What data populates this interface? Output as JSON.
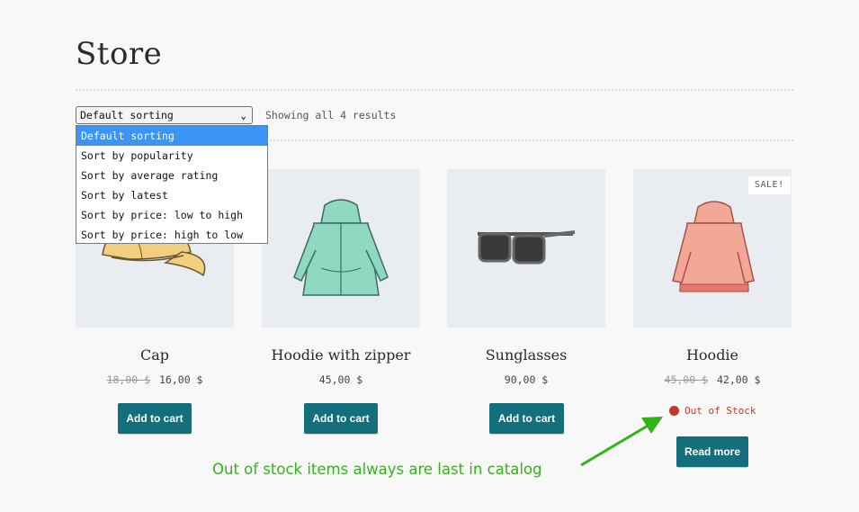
{
  "page": {
    "title": "Store"
  },
  "toolbar": {
    "sort_selected": "Default sorting",
    "results_text": "Showing all 4 results",
    "sort_options": [
      "Default sorting",
      "Sort by popularity",
      "Sort by average rating",
      "Sort by latest",
      "Sort by price: low to high",
      "Sort by price: high to low"
    ]
  },
  "products": [
    {
      "name": "Cap",
      "old_price": "18,00 $",
      "price": "16,00 $",
      "button": "Add to cart"
    },
    {
      "name": "Hoodie with zipper",
      "price": "45,00 $",
      "button": "Add to cart"
    },
    {
      "name": "Sunglasses",
      "price": "90,00 $",
      "button": "Add to cart"
    },
    {
      "name": "Hoodie",
      "old_price": "45,00 $",
      "price": "42,00 $",
      "button": "Read more",
      "badge": "SALE!",
      "stock": "Out of Stock"
    }
  ],
  "annotation": {
    "text": "Out of stock items always are last in catalog"
  },
  "colors": {
    "button": "#136f7c",
    "out_of_stock": "#c0392b",
    "annotation": "#33b31a",
    "dropdown_selected": "#3c95f5"
  }
}
